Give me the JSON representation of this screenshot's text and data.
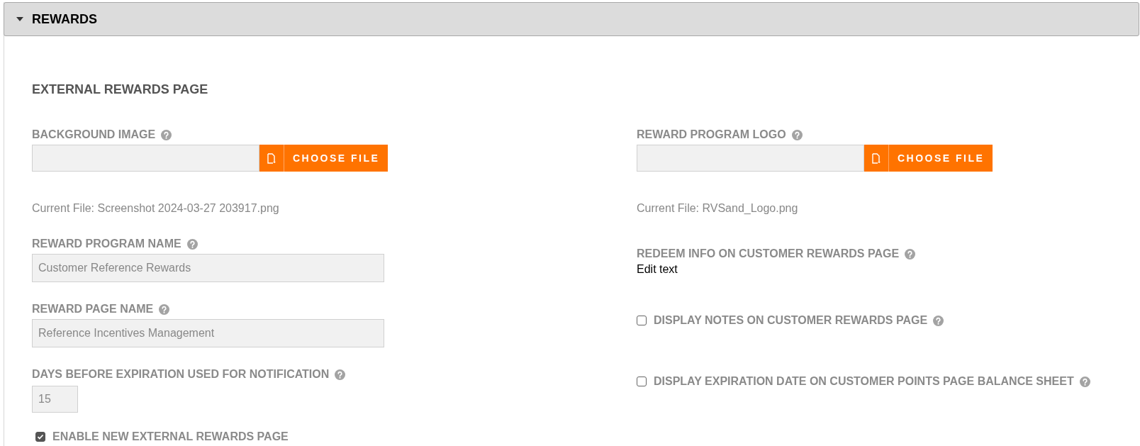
{
  "panel": {
    "title": "REWARDS",
    "expanded": true
  },
  "section_title": "EXTERNAL REWARDS PAGE",
  "left": [
    {
      "kind": "file",
      "label": "BACKGROUND IMAGE",
      "button": "CHOOSE FILE",
      "current_file": "Current File: Screenshot 2024-03-27 203917.png"
    },
    {
      "kind": "text",
      "label": "REWARD PROGRAM NAME",
      "value": "Customer Reference Rewards"
    },
    {
      "kind": "text",
      "label": "REWARD PAGE NAME",
      "value": "Reference Incentives Management"
    },
    {
      "kind": "number",
      "label": "DAYS BEFORE EXPIRATION USED FOR NOTIFICATION",
      "value": "15"
    },
    {
      "kind": "checkbox",
      "label": "ENABLE NEW EXTERNAL REWARDS PAGE",
      "checked": true,
      "help": false
    }
  ],
  "right": [
    {
      "kind": "file",
      "label": "REWARD PROGRAM LOGO",
      "button": "CHOOSE FILE",
      "current_file": "Current File: RVSand_Logo.png"
    },
    {
      "kind": "editor",
      "label": "REDEEM INFO ON CUSTOMER REWARDS PAGE",
      "value": "Edit text"
    },
    {
      "kind": "checkbox",
      "label": "DISPLAY NOTES ON CUSTOMER REWARDS PAGE",
      "checked": false,
      "help": true
    },
    {
      "kind": "checkbox",
      "label": "DISPLAY EXPIRATION DATE ON CUSTOMER POINTS PAGE BALANCE SHEET",
      "checked": false,
      "help": true
    }
  ]
}
